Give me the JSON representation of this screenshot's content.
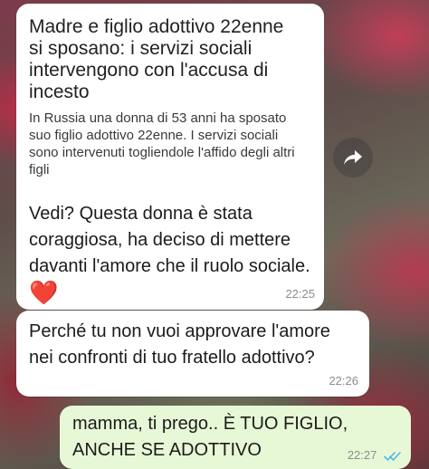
{
  "messages": [
    {
      "link_title": "Madre e figlio adottivo 22enne si sposano: i servizi sociali intervengono con l'accusa di incesto",
      "link_description": "In Russia una donna di 53 anni ha sposato suo figlio adottivo 22enne. I servizi sociali sono intervenuti togliendole l'affido degli altri figli",
      "text": "Vedi? Questa donna è stata coraggiosa, ha deciso di mettere davanti l'amore che il ruolo sociale.",
      "emoji": "❤️",
      "time": "22:25"
    },
    {
      "text": "Perché tu non vuoi approvare l'amore nei confronti di tuo fratello adottivo?",
      "time": "22:26"
    },
    {
      "text": "mamma, ti prego.. È TUO FIGLIO, ANCHE SE ADOTTIVO",
      "time": "22:27",
      "status": "read"
    }
  ],
  "colors": {
    "incoming_bubble": "#ffffff",
    "outgoing_bubble": "#e7f8d6",
    "read_ticks": "#4fb6ec"
  },
  "icons": {
    "forward": "forward-arrow-icon",
    "read_receipt": "double-check-icon"
  }
}
